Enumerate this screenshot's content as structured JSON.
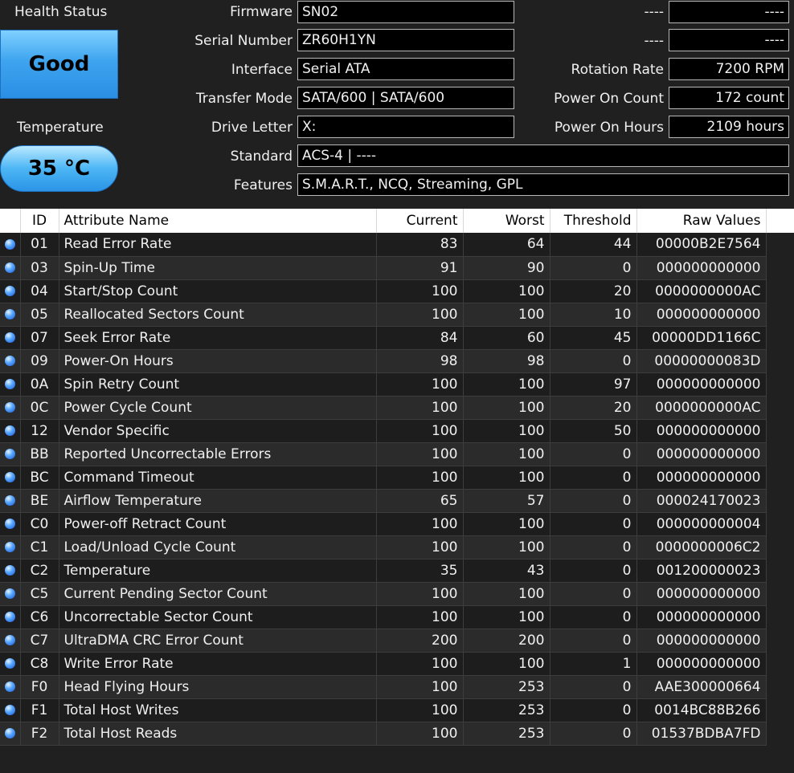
{
  "health": {
    "label": "Health Status",
    "value": "Good"
  },
  "temperature": {
    "label": "Temperature",
    "value": "35 °C"
  },
  "info": {
    "firmware": {
      "label": "Firmware",
      "value": "SN02"
    },
    "serial": {
      "label": "Serial Number",
      "value": "ZR60H1YN"
    },
    "interface": {
      "label": "Interface",
      "value": "Serial ATA"
    },
    "transfer": {
      "label": "Transfer Mode",
      "value": "SATA/600 | SATA/600"
    },
    "drive_letter": {
      "label": "Drive Letter",
      "value": "X:"
    },
    "standard": {
      "label": "Standard",
      "value": "ACS-4 | ----"
    },
    "features": {
      "label": "Features",
      "value": "S.M.A.R.T., NCQ, Streaming, GPL"
    }
  },
  "right_info": {
    "row1": {
      "label": "----",
      "value": "----"
    },
    "row2": {
      "label": "----",
      "value": "----"
    },
    "rotation": {
      "label": "Rotation Rate",
      "value": "7200 RPM"
    },
    "power_count": {
      "label": "Power On Count",
      "value": "172 count"
    },
    "power_hours": {
      "label": "Power On Hours",
      "value": "2109 hours"
    }
  },
  "table": {
    "headers": {
      "id": "ID",
      "name": "Attribute Name",
      "current": "Current",
      "worst": "Worst",
      "threshold": "Threshold",
      "raw": "Raw Values"
    },
    "rows": [
      {
        "id": "01",
        "name": "Read Error Rate",
        "current": "83",
        "worst": "64",
        "threshold": "44",
        "raw": "00000B2E7564"
      },
      {
        "id": "03",
        "name": "Spin-Up Time",
        "current": "91",
        "worst": "90",
        "threshold": "0",
        "raw": "000000000000"
      },
      {
        "id": "04",
        "name": "Start/Stop Count",
        "current": "100",
        "worst": "100",
        "threshold": "20",
        "raw": "0000000000AC"
      },
      {
        "id": "05",
        "name": "Reallocated Sectors Count",
        "current": "100",
        "worst": "100",
        "threshold": "10",
        "raw": "000000000000"
      },
      {
        "id": "07",
        "name": "Seek Error Rate",
        "current": "84",
        "worst": "60",
        "threshold": "45",
        "raw": "00000DD1166C"
      },
      {
        "id": "09",
        "name": "Power-On Hours",
        "current": "98",
        "worst": "98",
        "threshold": "0",
        "raw": "00000000083D"
      },
      {
        "id": "0A",
        "name": "Spin Retry Count",
        "current": "100",
        "worst": "100",
        "threshold": "97",
        "raw": "000000000000"
      },
      {
        "id": "0C",
        "name": "Power Cycle Count",
        "current": "100",
        "worst": "100",
        "threshold": "20",
        "raw": "0000000000AC"
      },
      {
        "id": "12",
        "name": "Vendor Specific",
        "current": "100",
        "worst": "100",
        "threshold": "50",
        "raw": "000000000000"
      },
      {
        "id": "BB",
        "name": "Reported Uncorrectable Errors",
        "current": "100",
        "worst": "100",
        "threshold": "0",
        "raw": "000000000000"
      },
      {
        "id": "BC",
        "name": "Command Timeout",
        "current": "100",
        "worst": "100",
        "threshold": "0",
        "raw": "000000000000"
      },
      {
        "id": "BE",
        "name": "Airflow Temperature",
        "current": "65",
        "worst": "57",
        "threshold": "0",
        "raw": "000024170023"
      },
      {
        "id": "C0",
        "name": "Power-off Retract Count",
        "current": "100",
        "worst": "100",
        "threshold": "0",
        "raw": "000000000004"
      },
      {
        "id": "C1",
        "name": "Load/Unload Cycle Count",
        "current": "100",
        "worst": "100",
        "threshold": "0",
        "raw": "0000000006C2"
      },
      {
        "id": "C2",
        "name": "Temperature",
        "current": "35",
        "worst": "43",
        "threshold": "0",
        "raw": "001200000023"
      },
      {
        "id": "C5",
        "name": "Current Pending Sector Count",
        "current": "100",
        "worst": "100",
        "threshold": "0",
        "raw": "000000000000"
      },
      {
        "id": "C6",
        "name": "Uncorrectable Sector Count",
        "current": "100",
        "worst": "100",
        "threshold": "0",
        "raw": "000000000000"
      },
      {
        "id": "C7",
        "name": "UltraDMA CRC Error Count",
        "current": "200",
        "worst": "200",
        "threshold": "0",
        "raw": "000000000000"
      },
      {
        "id": "C8",
        "name": "Write Error Rate",
        "current": "100",
        "worst": "100",
        "threshold": "1",
        "raw": "000000000000"
      },
      {
        "id": "F0",
        "name": "Head Flying Hours",
        "current": "100",
        "worst": "253",
        "threshold": "0",
        "raw": "AAE300000664"
      },
      {
        "id": "F1",
        "name": "Total Host Writes",
        "current": "100",
        "worst": "253",
        "threshold": "0",
        "raw": "0014BC88B266"
      },
      {
        "id": "F2",
        "name": "Total Host Reads",
        "current": "100",
        "worst": "253",
        "threshold": "0",
        "raw": "01537BDBA7FD"
      }
    ]
  },
  "status_icon": "blue-circle-icon",
  "colors": {
    "good": "#3ea4ef",
    "background": "#202020"
  }
}
